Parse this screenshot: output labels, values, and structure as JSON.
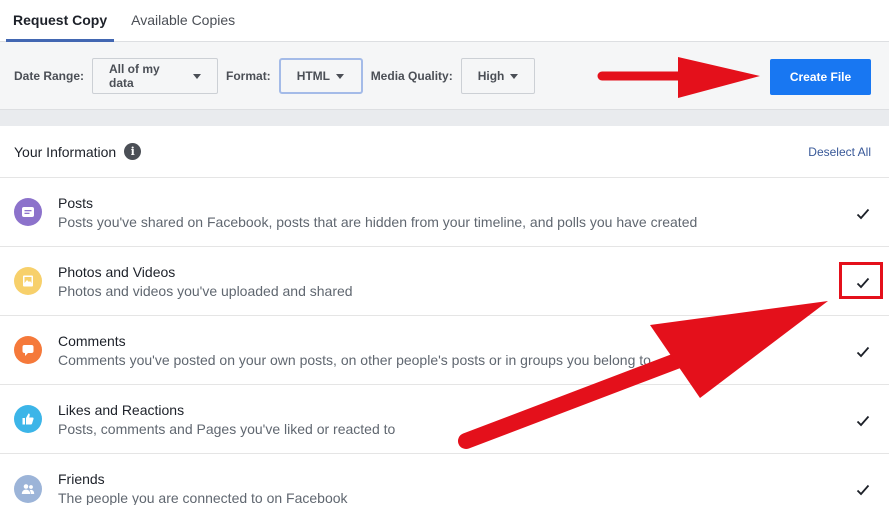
{
  "tabs": [
    {
      "label": "Request Copy",
      "active": true
    },
    {
      "label": "Available Copies",
      "active": false
    }
  ],
  "filters": {
    "date_range_label": "Date Range:",
    "date_range_value": "All of my data",
    "format_label": "Format:",
    "format_value": "HTML",
    "media_quality_label": "Media Quality:",
    "media_quality_value": "High",
    "create_button": "Create File"
  },
  "info": {
    "title": "Your Information",
    "info_icon": "i",
    "deselect_all": "Deselect All"
  },
  "items": [
    {
      "title": "Posts",
      "description": "Posts you've shared on Facebook, posts that are hidden from your timeline, and polls you have created",
      "icon": "posts-icon",
      "color": "#8c72cb",
      "checked": true
    },
    {
      "title": "Photos and Videos",
      "description": "Photos and videos you've uploaded and shared",
      "icon": "photos-icon",
      "color": "#f7d06b",
      "checked": true
    },
    {
      "title": "Comments",
      "description": "Comments you've posted on your own posts, on other people's posts or in groups you belong to",
      "icon": "comments-icon",
      "color": "#f5793a",
      "checked": true
    },
    {
      "title": "Likes and Reactions",
      "description": "Posts, comments and Pages you've liked or reacted to",
      "icon": "likes-icon",
      "color": "#3cb5e8",
      "checked": true
    },
    {
      "title": "Friends",
      "description": "The people you are connected to on Facebook",
      "icon": "friends-icon",
      "color": "#9cb4d8",
      "checked": true
    }
  ],
  "colors": {
    "accent": "#1877f2",
    "annotation": "#e4101b"
  }
}
